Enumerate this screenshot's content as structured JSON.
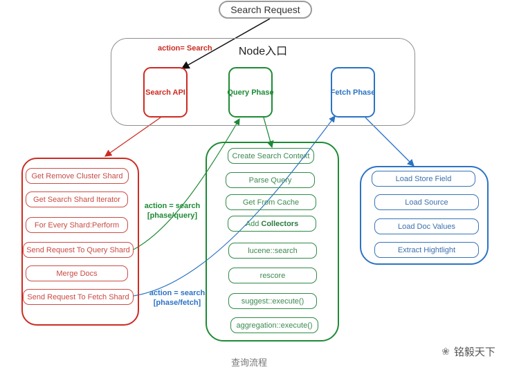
{
  "diagram": {
    "request": "Search Request",
    "node": {
      "title": "Node入口",
      "entry_action_label": "action= Search",
      "phases": {
        "search_api": "Search API",
        "query_phase": "Query Phase",
        "fetch_phase": "Fetch Phase"
      }
    },
    "search_api_steps": [
      "Get Remove Cluster Shard",
      "Get Search Shard Iterator",
      "For Every Shard:Perform",
      "Send Request To Query Shard",
      "Merge Docs",
      "Send Request To Fetch Shard"
    ],
    "query_phase_steps": [
      {
        "text": "Create Search Context"
      },
      {
        "text": "Parse Query"
      },
      {
        "text": "Get From Cache"
      },
      {
        "text": "Add",
        "bold": "Collectors"
      },
      {
        "text": "lucene::search"
      },
      {
        "text": "rescore"
      },
      {
        "text": "suggest::execute()"
      },
      {
        "text": "aggregation::execute()"
      }
    ],
    "fetch_phase_steps": [
      "Load Store Field",
      "Load Source",
      "Load Doc Values",
      "Extract Hightlight"
    ],
    "edge_labels": {
      "query": {
        "line1": "action = search",
        "line2": "[phase/query]"
      },
      "fetch": {
        "line1": "action = search",
        "line2": "[phase/fetch]"
      }
    },
    "colors": {
      "search_api": "#cc2b22",
      "query_phase": "#1e8a35",
      "fetch_phase": "#2b73c4",
      "request": "#9a9a9a",
      "node_border": "#8e8e8e"
    }
  },
  "caption": "查询流程",
  "watermark": {
    "icon": "wechat-icon",
    "text": "铭毅天下"
  }
}
